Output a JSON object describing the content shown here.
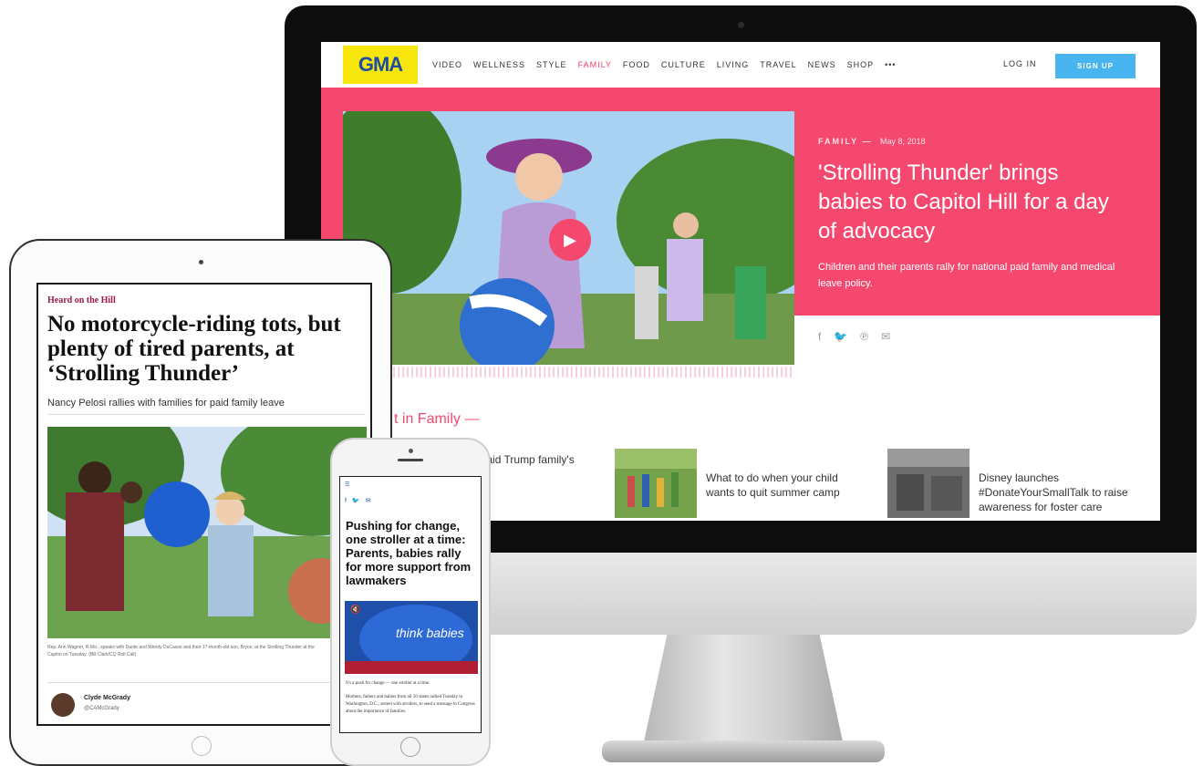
{
  "colors": {
    "gma_pink": "#f5486f",
    "gma_logo_yellow": "#f7e60d",
    "gma_logo_blue": "#1c4ea0",
    "gma_signup_blue": "#48b5f0",
    "wp_kicker": "#a01848"
  },
  "desktop": {
    "logo": "GMA",
    "nav": [
      "VIDEO",
      "WELLNESS",
      "STYLE",
      "FAMILY",
      "FOOD",
      "CULTURE",
      "LIVING",
      "TRAVEL",
      "NEWS",
      "SHOP",
      "•••"
    ],
    "active_nav": "FAMILY",
    "login": "LOG IN",
    "signup": "SIGN UP",
    "kicker": "FAMILY",
    "kicker_sep": "—",
    "date": "May 8, 2018",
    "headline": "'Strolling Thunder' brings babies to Capitol Hill for a day of advocacy",
    "dek": "Children and their parents rally for national paid family and medical leave policy.",
    "share_icons": [
      "facebook-icon",
      "twitter-icon",
      "pinterest-icon",
      "email-icon"
    ],
    "next_label": "t in Family —",
    "cards": [
      {
        "title": "Gillibrand on paid Trump family's erest"
      },
      {
        "title": "What to do when your child wants to quit summer camp"
      },
      {
        "title": "Disney launches #DonateYourSmallTalk to raise awareness for foster care"
      }
    ]
  },
  "tablet": {
    "kicker": "Heard on the Hill",
    "headline": "No motorcycle-riding tots, but plenty of tired parents, at ‘Strolling Thunder’",
    "dek": "Nancy Pelosi rallies with families for paid family leave",
    "caption": "Rep. Ann Wagner, R-Mo., speaks with Dante and Wendy DuCasse and their 17-month-old son, Bryce, at the Strolling Thunder at the Capitol on Tuesday. (Bill Clark/CQ Roll Call)",
    "author": "Clyde McGrady",
    "handle": "@CAMcGrady"
  },
  "phone": {
    "headline": "Pushing for change, one stroller at a time: Parents, babies rally for more support from lawmakers",
    "balloon_text": "think babies",
    "p1": "It's a push for change — one stroller at a time.",
    "p2": "Mothers, fathers and babies from all 50 states rallied Tuesday in Washington, D.C., armed with strollers, to send a message to Congress about the importance of families."
  }
}
